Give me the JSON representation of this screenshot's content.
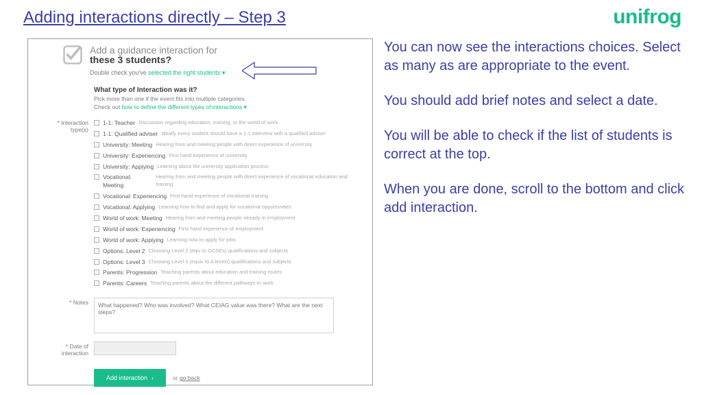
{
  "title": "Adding interactions directly – Step 3",
  "logo": "unifrog",
  "right": {
    "p1": "You can now see the interactions choices. Select as many as are appropriate to the event.",
    "p2": "You should add brief notes and select a date.",
    "p3": "You will be able to check if the list of students is correct at the top.",
    "p4": "When you are done, scroll to the bottom and click add interaction."
  },
  "panel": {
    "hdr1": "Add a guidance interaction for",
    "hdr2": "these 3 students?",
    "hdr_sub_a": "Double check you've ",
    "hdr_sub_b": "selected the right students ▾",
    "section_q": "What type of Interaction was it?",
    "section_sub_a": "Pick more than one if the event fits into multiple categories.",
    "section_sub_b": "Check out ",
    "section_sub_c": "how to define the different types of interactions ▾",
    "label_types": "* Interaction type(s)",
    "label_notes": "* Notes",
    "label_date": "* Date of interaction",
    "notes_placeholder": "What happened? Who was involved? What CEIAG value was there? What are the next steps?",
    "add_btn": "Add interaction",
    "or": "or ",
    "goback": "go back",
    "options": [
      {
        "name": "1-1: Teacher",
        "desc": "Discussion regarding education, training, or the world of work"
      },
      {
        "name": "1-1: Qualified adviser",
        "desc": "Ideally every student should have a 1-1 interview with a qualified adviser"
      },
      {
        "name": "University: Meeting",
        "desc": "Hearing from and meeting people with direct experience of university"
      },
      {
        "name": "University: Experiencing",
        "desc": "First hand experience of university"
      },
      {
        "name": "University: Applying",
        "desc": "Learning about the university application process"
      },
      {
        "name": "Vocational: Meeting",
        "desc": "Hearing from and meeting people with direct experience of vocational education and training"
      },
      {
        "name": "Vocational: Experiencing",
        "desc": "First hand experience of vocational training"
      },
      {
        "name": "Vocational: Applying",
        "desc": "Learning how to find and apply for vocational opportunities"
      },
      {
        "name": "World of work: Meeting",
        "desc": "Hearing from and meeting people already in employment"
      },
      {
        "name": "World of work: Experiencing",
        "desc": "First hand experience of employment"
      },
      {
        "name": "World of work: Applying",
        "desc": "Learning how to apply for jobs"
      },
      {
        "name": "Options: Level 2",
        "desc": "Choosing Level 2 (eqiv to GCSEs) qualifications and subjects"
      },
      {
        "name": "Options: Level 3",
        "desc": "Choosing Level 3 (equiv to A levels) qualifications and subjects"
      },
      {
        "name": "Parents: Progression",
        "desc": "Teaching parents about education and training routes"
      },
      {
        "name": "Parents: Careers",
        "desc": "Teaching parents about the different pathways to work"
      }
    ]
  }
}
